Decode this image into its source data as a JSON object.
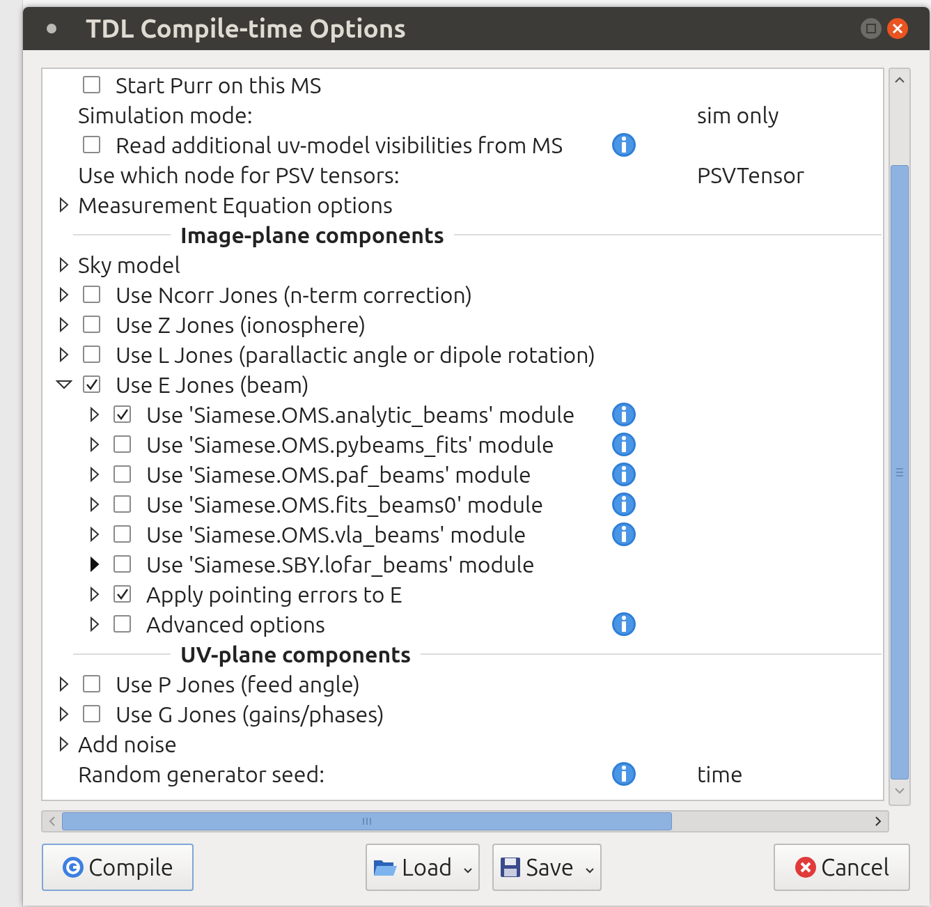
{
  "window": {
    "title": "TDL Compile-time Options"
  },
  "options": [
    {
      "kind": "checkbox",
      "label": "Start Purr on this MS",
      "checked": false,
      "expandable": false,
      "info": false
    },
    {
      "kind": "setting",
      "label": "Simulation mode:",
      "value": "sim only",
      "expandable": false,
      "info": false
    },
    {
      "kind": "checkbox",
      "label": "Read additional uv-model visibilities from MS",
      "checked": false,
      "expandable": false,
      "info": true
    },
    {
      "kind": "setting",
      "label": "Use which node for PSV tensors:",
      "value": "PSVTensor",
      "expandable": false,
      "info": false
    },
    {
      "kind": "group",
      "label": "Measurement Equation options",
      "expandable": true,
      "expanded": false,
      "arrow_filled": false,
      "info": false
    },
    {
      "kind": "section",
      "label": "Image-plane components"
    },
    {
      "kind": "group",
      "label": "Sky model",
      "expandable": true,
      "expanded": false,
      "arrow_filled": false,
      "info": false
    },
    {
      "kind": "checkbox",
      "label": "Use Ncorr Jones (n-term correction)",
      "checked": false,
      "expandable": true,
      "expanded": false,
      "arrow_filled": false,
      "info": false
    },
    {
      "kind": "checkbox",
      "label": "Use Z Jones (ionosphere)",
      "checked": false,
      "expandable": true,
      "expanded": false,
      "arrow_filled": false,
      "info": false
    },
    {
      "kind": "checkbox",
      "label": "Use L Jones (parallactic angle or dipole rotation)",
      "checked": false,
      "expandable": true,
      "expanded": false,
      "arrow_filled": false,
      "info": false
    },
    {
      "kind": "checkbox",
      "label": "Use E Jones (beam)",
      "checked": true,
      "expandable": true,
      "expanded": true,
      "arrow_filled": false,
      "info": false,
      "children": [
        {
          "kind": "checkbox",
          "label": "Use 'Siamese.OMS.analytic_beams' module",
          "checked": true,
          "expandable": true,
          "expanded": false,
          "arrow_filled": false,
          "info": true
        },
        {
          "kind": "checkbox",
          "label": "Use 'Siamese.OMS.pybeams_fits' module",
          "checked": false,
          "expandable": true,
          "expanded": false,
          "arrow_filled": false,
          "info": true
        },
        {
          "kind": "checkbox",
          "label": "Use 'Siamese.OMS.paf_beams' module",
          "checked": false,
          "expandable": true,
          "expanded": false,
          "arrow_filled": false,
          "info": true
        },
        {
          "kind": "checkbox",
          "label": "Use 'Siamese.OMS.fits_beams0' module",
          "checked": false,
          "expandable": true,
          "expanded": false,
          "arrow_filled": false,
          "info": true
        },
        {
          "kind": "checkbox",
          "label": "Use 'Siamese.OMS.vla_beams' module",
          "checked": false,
          "expandable": true,
          "expanded": false,
          "arrow_filled": false,
          "info": true
        },
        {
          "kind": "checkbox",
          "label": "Use 'Siamese.SBY.lofar_beams' module",
          "checked": false,
          "expandable": true,
          "expanded": false,
          "arrow_filled": true,
          "info": false
        },
        {
          "kind": "checkbox",
          "label": "Apply pointing errors to E",
          "checked": true,
          "expandable": true,
          "expanded": false,
          "arrow_filled": false,
          "info": false
        },
        {
          "kind": "checkbox",
          "label": "Advanced options",
          "checked": false,
          "expandable": true,
          "expanded": false,
          "arrow_filled": false,
          "info": true
        }
      ]
    },
    {
      "kind": "section",
      "label": "UV-plane components"
    },
    {
      "kind": "checkbox",
      "label": "Use P Jones (feed angle)",
      "checked": false,
      "expandable": true,
      "expanded": false,
      "arrow_filled": false,
      "info": false
    },
    {
      "kind": "checkbox",
      "label": "Use G Jones (gains/phases)",
      "checked": false,
      "expandable": true,
      "expanded": false,
      "arrow_filled": false,
      "info": false
    },
    {
      "kind": "group",
      "label": "Add noise",
      "expandable": true,
      "expanded": false,
      "arrow_filled": false,
      "info": false
    },
    {
      "kind": "setting",
      "label": "Random generator seed:",
      "value": "time",
      "expandable": false,
      "info": true
    }
  ],
  "buttons": [
    {
      "kind": "compile",
      "label": "Compile",
      "dropdown": false
    },
    {
      "kind": "load",
      "label": "Load",
      "dropdown": true
    },
    {
      "kind": "save",
      "label": "Save",
      "dropdown": true
    },
    {
      "kind": "cancel",
      "label": "Cancel",
      "dropdown": false
    }
  ]
}
